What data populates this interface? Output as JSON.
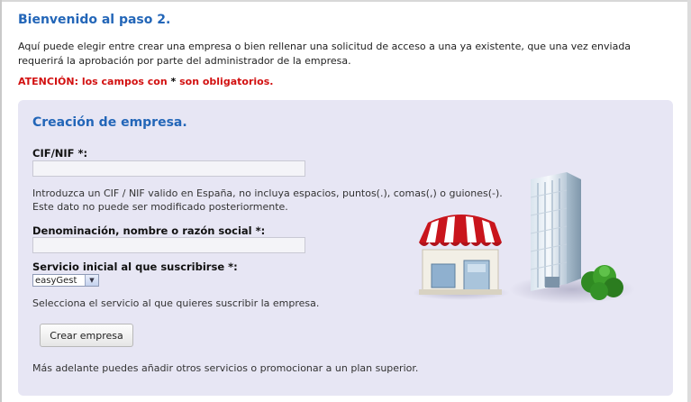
{
  "header": {
    "title": "Bienvenido al paso 2.",
    "intro": "Aquí puede elegir entre crear una empresa o bien rellenar una solicitud de acceso a una ya existente, que una vez enviada requerirá la aprobación por parte del administrador de la empresa.",
    "warning_prefix": "ATENCIÓN: los campos con ",
    "warning_star": "*",
    "warning_suffix": " son obligatorios."
  },
  "form": {
    "title": "Creación de empresa.",
    "cif_label": "CIF/NIF *:",
    "cif_value": "",
    "cif_hint_line1": "Introduzca un CIF / NIF valido en España, no incluya espacios, puntos(.), comas(,) o guiones(-).",
    "cif_hint_line2": "Este dato no puede ser modificado posteriormente.",
    "name_label": "Denominación, nombre o razón social *:",
    "name_value": "",
    "service_label": "Servicio inicial al que suscribirse *:",
    "service_selected": "easyGest",
    "service_hint": "Selecciona el servicio al que quieres suscribir la empresa.",
    "submit_label": "Crear empresa",
    "footer_note": "Más adelante puedes añadir otros servicios o promocionar a un plan superior."
  },
  "illustration": {
    "icons": [
      "shop-icon",
      "office-building-icon",
      "tree-icon"
    ]
  }
}
